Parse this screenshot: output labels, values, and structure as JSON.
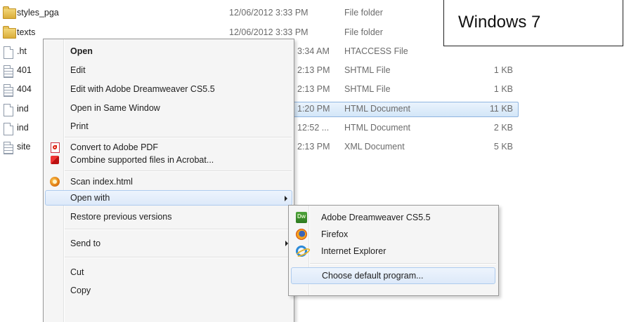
{
  "files": [
    {
      "name": "styles_pga",
      "date": "12/06/2012 3:33 PM",
      "type": "File folder",
      "size": "",
      "icon": "folder-icon"
    },
    {
      "name": "texts",
      "date": "12/06/2012 3:33 PM",
      "type": "File folder",
      "size": "",
      "icon": "folder-icon"
    },
    {
      "name": ".ht",
      "date": "3:34 AM",
      "type": "HTACCESS File",
      "size": "",
      "icon": "file-icon"
    },
    {
      "name": "401",
      "date": "2:13 PM",
      "type": "SHTML File",
      "size": "1 KB",
      "icon": "file-icon"
    },
    {
      "name": "404",
      "date": "2:13 PM",
      "type": "SHTML File",
      "size": "1 KB",
      "icon": "file-icon"
    },
    {
      "name": "ind",
      "date": "1:20 PM",
      "type": "HTML Document",
      "size": "11 KB",
      "icon": "file-icon"
    },
    {
      "name": "ind",
      "date": "12:52 ...",
      "type": "HTML Document",
      "size": "2 KB",
      "icon": "file-icon"
    },
    {
      "name": "site",
      "date": "2:13 PM",
      "type": "XML Document",
      "size": "5 KB",
      "icon": "xml-file-icon"
    }
  ],
  "os_label": "Windows 7",
  "context_menu": {
    "open": "Open",
    "edit": "Edit",
    "edit_dreamweaver": "Edit with Adobe Dreamweaver CS5.5",
    "open_same_window": "Open in Same Window",
    "print": "Print",
    "convert_pdf": "Convert to Adobe PDF",
    "combine_acrobat": "Combine supported files in Acrobat...",
    "scan": "Scan index.html",
    "open_with": "Open with",
    "restore": "Restore previous versions",
    "send_to": "Send to",
    "cut": "Cut",
    "copy": "Copy"
  },
  "open_with_menu": {
    "dreamweaver": "Adobe Dreamweaver CS5.5",
    "firefox": "Firefox",
    "ie": "Internet Explorer",
    "choose_default": "Choose default program..."
  }
}
